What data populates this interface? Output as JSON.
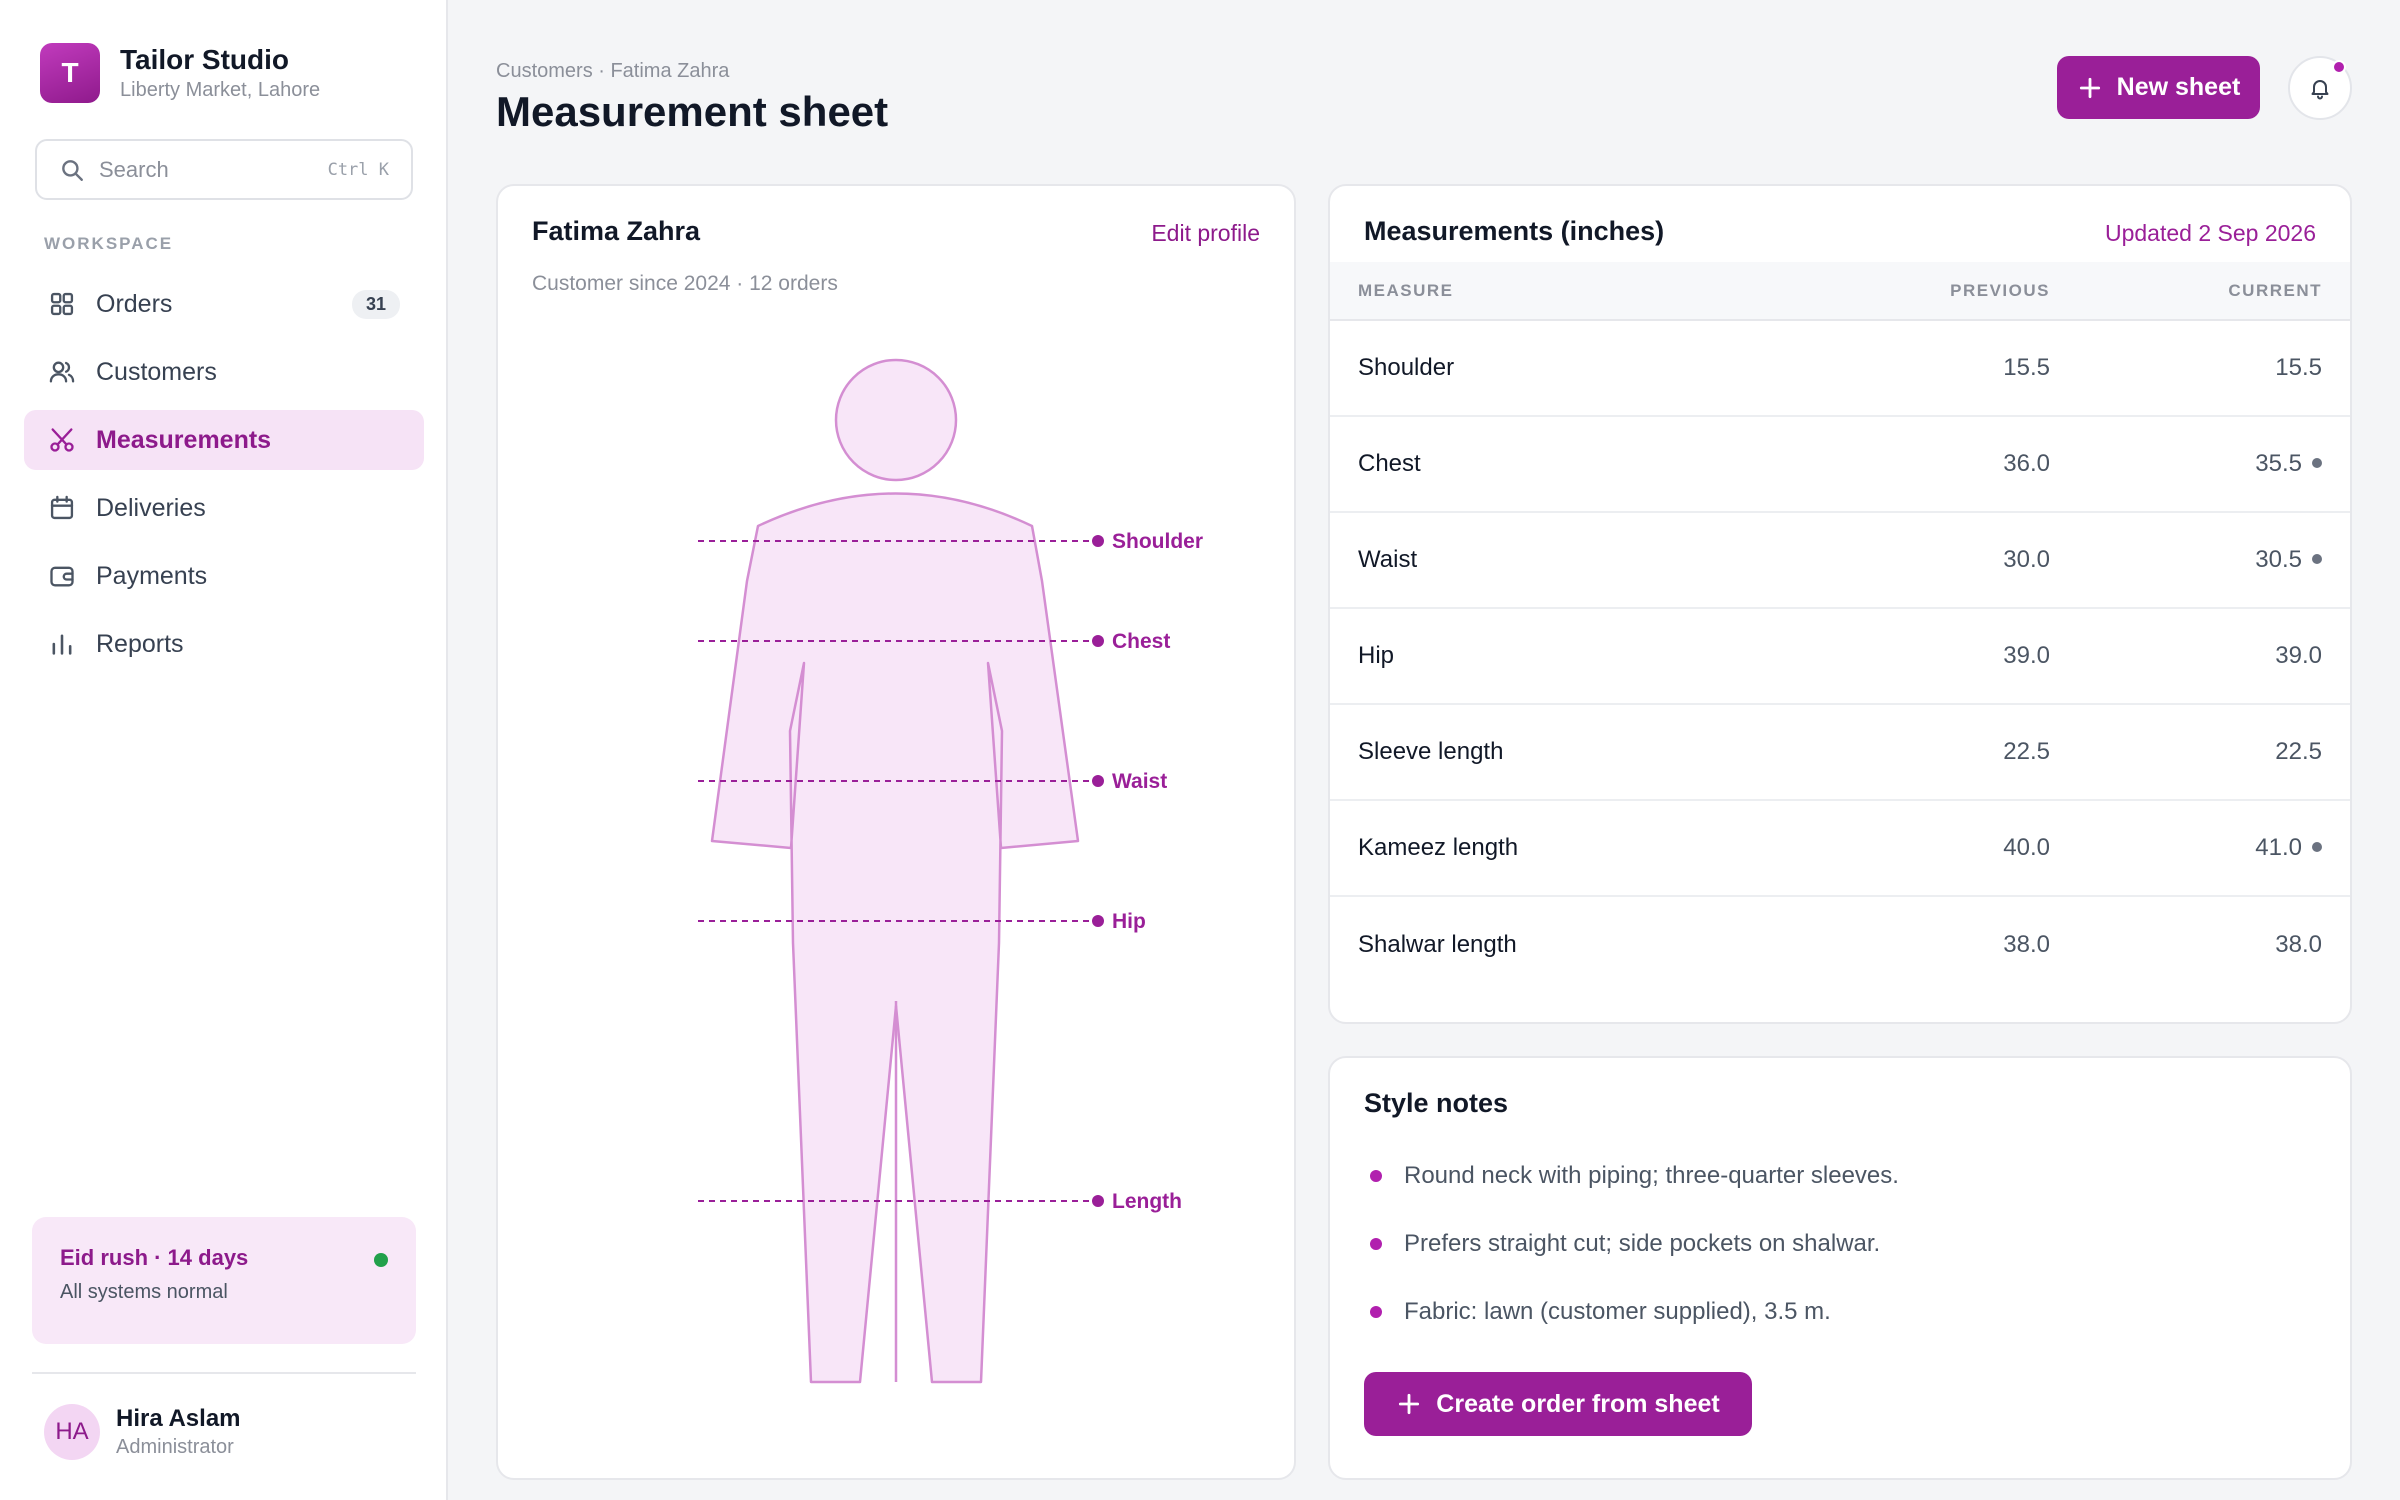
{
  "brand": {
    "initial": "T",
    "name": "Tailor Studio",
    "location": "Liberty Market, Lahore"
  },
  "search": {
    "placeholder": "Search",
    "shortcut": "Ctrl K"
  },
  "sidebar": {
    "section_label": "WORKSPACE",
    "items": [
      {
        "label": "Orders",
        "icon": "grid-icon",
        "badge": "31"
      },
      {
        "label": "Customers",
        "icon": "users-icon"
      },
      {
        "label": "Measurements",
        "icon": "scissors-icon",
        "active": true
      },
      {
        "label": "Deliveries",
        "icon": "calendar-icon"
      },
      {
        "label": "Payments",
        "icon": "wallet-icon"
      },
      {
        "label": "Reports",
        "icon": "bar-chart-icon"
      }
    ],
    "status": {
      "title": "Eid rush · 14 days",
      "subtitle": "All systems normal",
      "dot_color": "#22a04b"
    },
    "user": {
      "initials": "HA",
      "name": "Hira Aslam",
      "role": "Administrator"
    }
  },
  "header": {
    "breadcrumb": "Customers · Fatima Zahra",
    "title": "Measurement sheet",
    "new_sheet_label": "New sheet",
    "notification_icon": "bell-icon"
  },
  "profile": {
    "name": "Fatima Zahra",
    "edit_label": "Edit profile",
    "meta": "Customer since 2024 · 12 orders",
    "figure_labels": [
      "Shoulder",
      "Chest",
      "Waist",
      "Hip",
      "Length"
    ]
  },
  "measurements": {
    "title": "Measurements (inches)",
    "updated": "Updated 2 Sep 2026",
    "columns": [
      "MEASURE",
      "PREVIOUS",
      "CURRENT"
    ],
    "rows": [
      {
        "measure": "Shoulder",
        "previous": "15.5",
        "current": "15.5",
        "changed": false
      },
      {
        "measure": "Chest",
        "previous": "36.0",
        "current": "35.5",
        "changed": true
      },
      {
        "measure": "Waist",
        "previous": "30.0",
        "current": "30.5",
        "changed": true
      },
      {
        "measure": "Hip",
        "previous": "39.0",
        "current": "39.0",
        "changed": false
      },
      {
        "measure": "Sleeve length",
        "previous": "22.5",
        "current": "22.5",
        "changed": false
      },
      {
        "measure": "Kameez length",
        "previous": "40.0",
        "current": "41.0",
        "changed": true
      },
      {
        "measure": "Shalwar length",
        "previous": "38.0",
        "current": "38.0",
        "changed": false
      }
    ]
  },
  "style_notes": {
    "title": "Style notes",
    "items": [
      "Round neck with piping; three-quarter sleeves.",
      "Prefers straight cut; side pockets on shalwar.",
      "Fabric: lawn (customer supplied), 3.5 m."
    ],
    "action_label": "Create order from sheet"
  },
  "colors": {
    "accent": "#9a1f98",
    "accent_light": "#f6e3f6",
    "figure_fill": "#f8e6f8",
    "figure_stroke": "#d48ed2"
  }
}
